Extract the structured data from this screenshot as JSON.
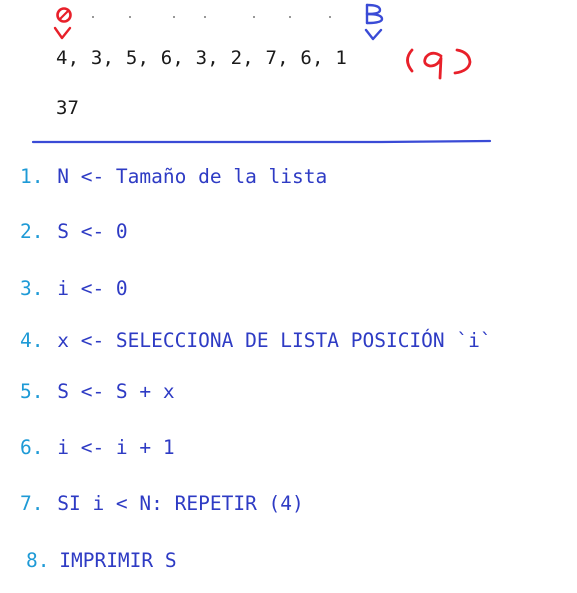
{
  "list": {
    "values": "4, 3, 5, 6, 3, 2, 7, 6, 1",
    "count_note": "(9)",
    "start_marker": "0",
    "end_marker": "B"
  },
  "result": {
    "value": "37"
  },
  "steps": [
    {
      "num": "1.",
      "code": "N <- Tamaño de la lista"
    },
    {
      "num": "2.",
      "code": "S <- 0"
    },
    {
      "num": "3.",
      "code": "i <- 0"
    },
    {
      "num": "4.",
      "code": "x <- SELECCIONA DE LISTA POSICIÓN `i`"
    },
    {
      "num": "5.",
      "code": "S <- S + x"
    },
    {
      "num": "6.",
      "code": "i <- i + 1"
    },
    {
      "num": "7.",
      "code": "SI i < N: REPETIR (4)"
    },
    {
      "num": "8.",
      "code": "IMPRIMIR S"
    }
  ],
  "colors": {
    "red_ink": "#e8202a",
    "blue_ink": "#3a4bd6",
    "step_number": "#1e9ad6",
    "step_code": "#2e3bc4",
    "text": "#1a1a1a"
  }
}
